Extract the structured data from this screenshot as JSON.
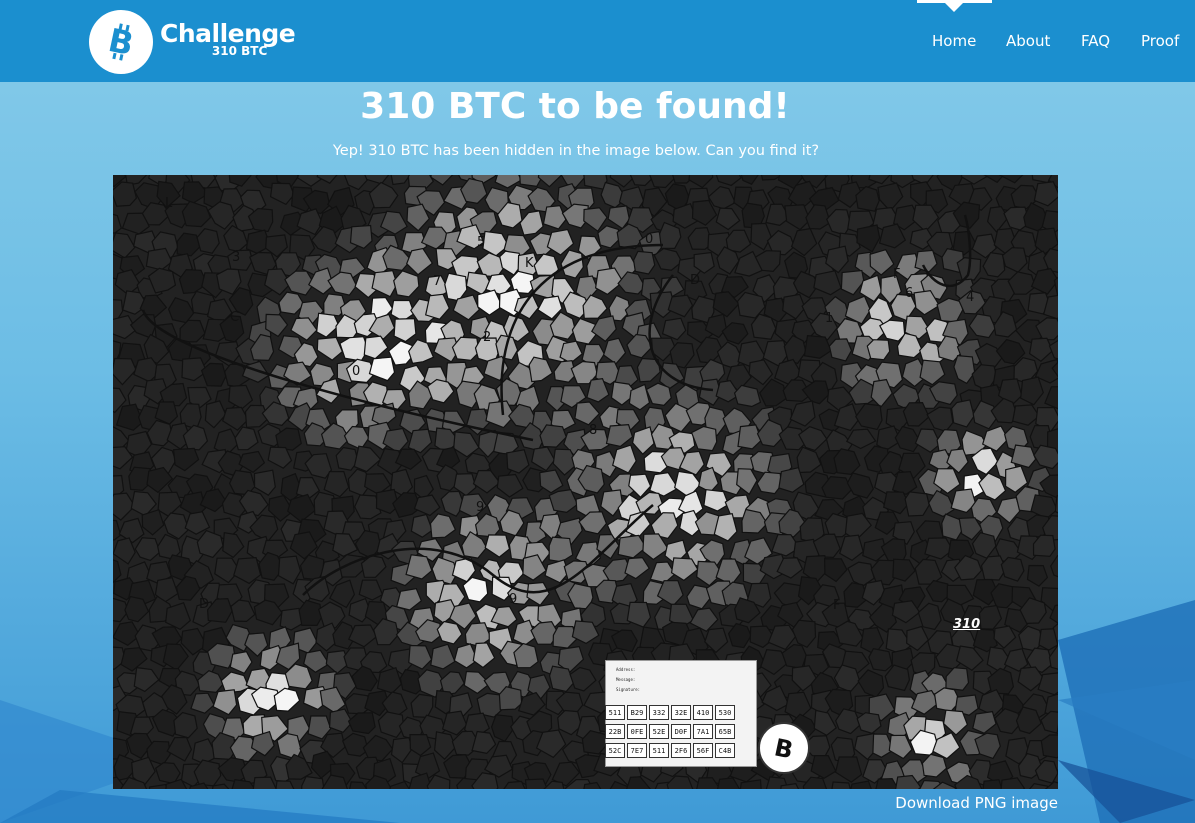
{
  "brand": {
    "title": "Challenge",
    "subtitle": "310 BTC",
    "accent": "#1b8fcf"
  },
  "nav": {
    "items": [
      "Home",
      "About",
      "FAQ",
      "Proof"
    ],
    "active": "Home"
  },
  "hero": {
    "title": "310 BTC to be found!",
    "subtitle": "Yep! 310 BTC has been hidden in the image below. Can you find it?"
  },
  "puzzle": {
    "labels": [
      "L",
      "3",
      "C",
      "5",
      "0",
      "7",
      "2",
      "K",
      "D",
      "F",
      "6",
      "4",
      "1",
      "0",
      "8",
      "9",
      "9",
      "D",
      "F",
      "310"
    ],
    "slip": {
      "lines": [
        "Address:",
        "Message:",
        "Signature:"
      ],
      "grid": [
        "511",
        "B29",
        "332",
        "32E",
        "410",
        "530",
        "22B",
        "0FE",
        "52E",
        "D0F",
        "7A1",
        "65B",
        "52C",
        "7E7",
        "511",
        "2F6",
        "56F",
        "C4B"
      ]
    }
  },
  "download": {
    "label": "Download PNG image"
  }
}
